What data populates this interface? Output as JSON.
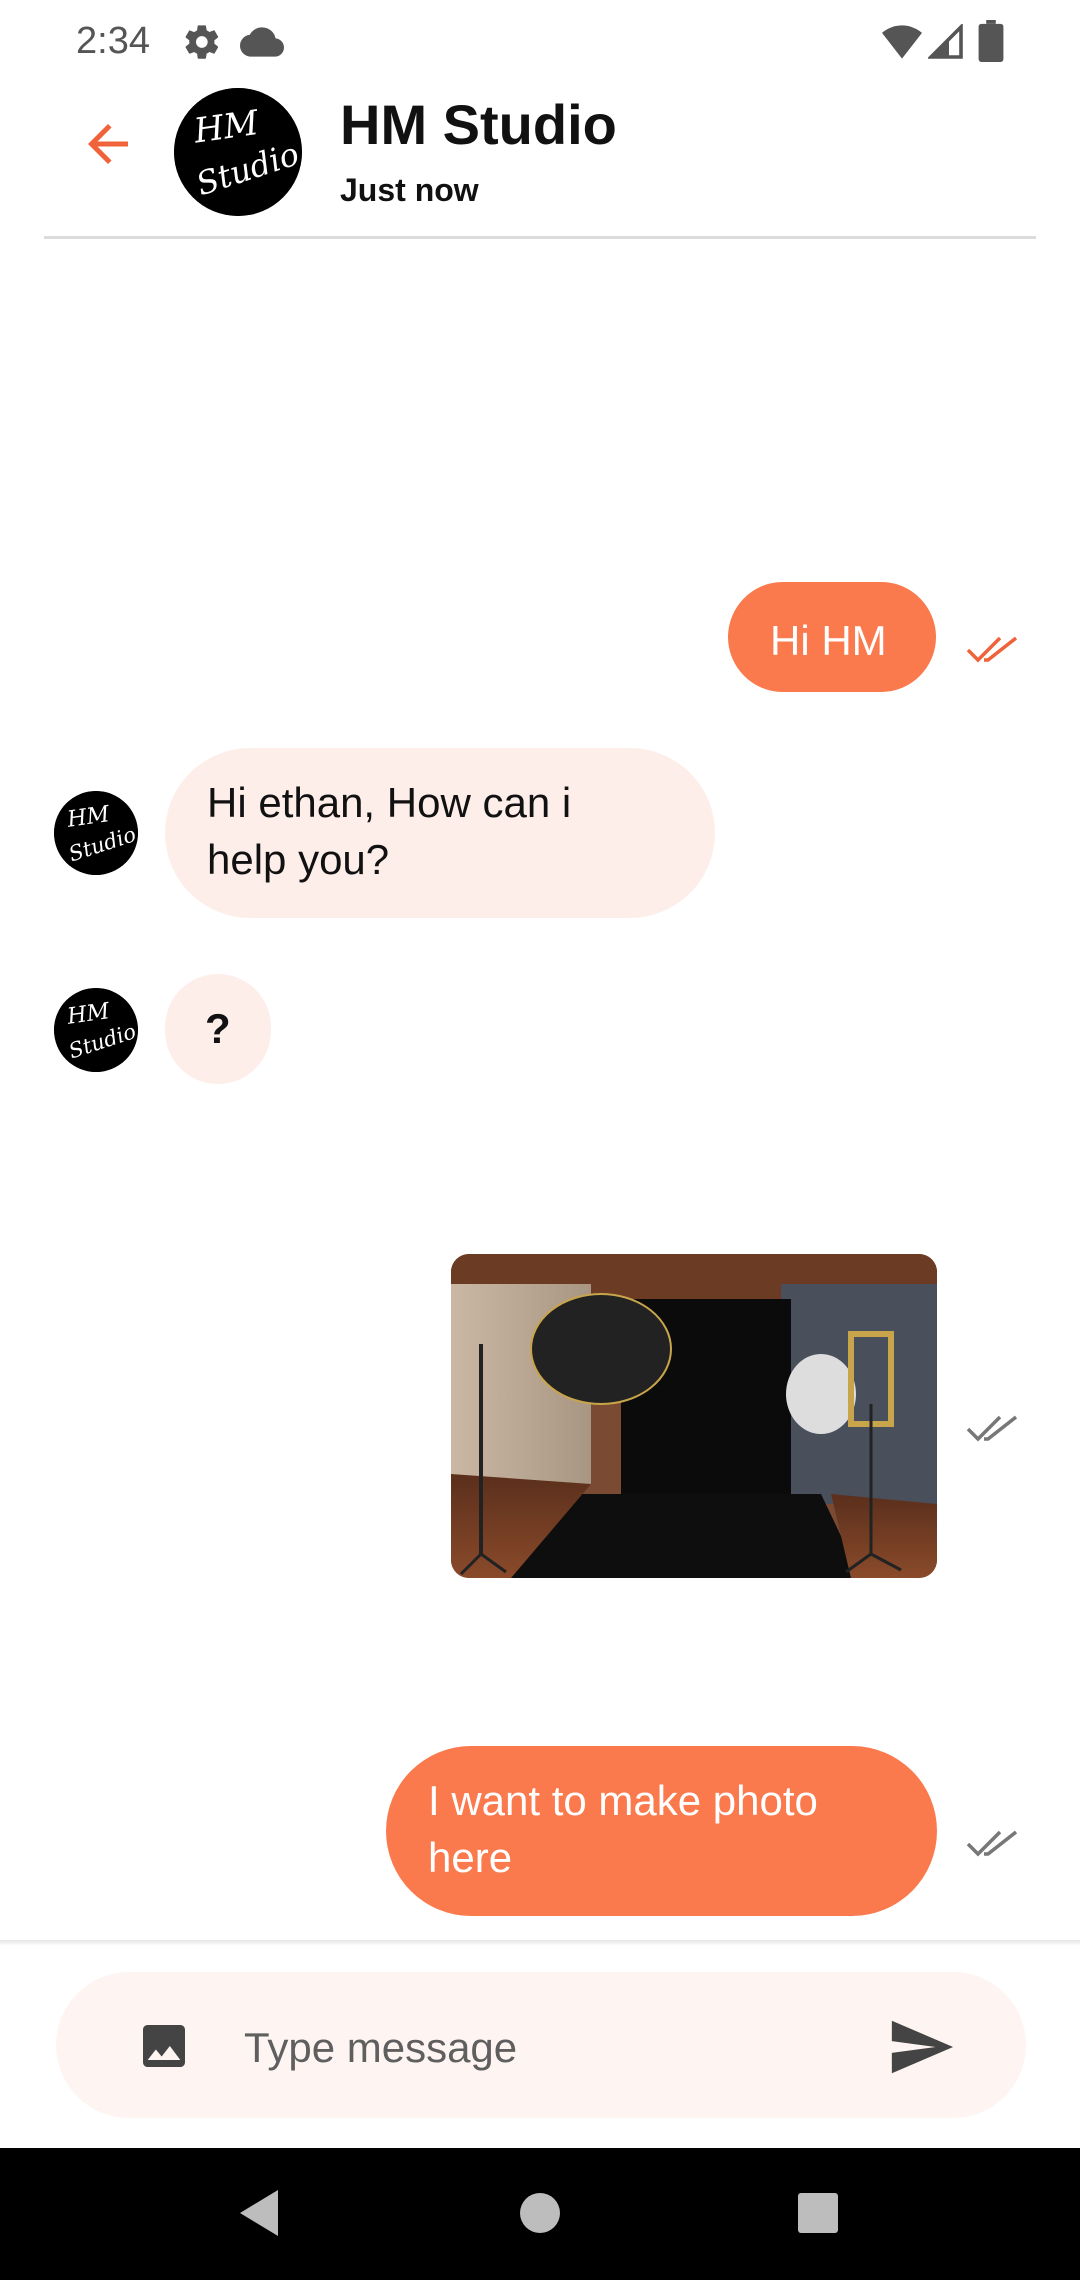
{
  "status_bar": {
    "time": "2:34",
    "icons": [
      "settings-icon",
      "cloud-icon",
      "wifi-icon",
      "signal-icon",
      "battery-icon"
    ]
  },
  "header": {
    "title": "HM Studio",
    "subtitle": "Just now",
    "avatar_text": [
      "HM",
      "Studio"
    ],
    "back_icon": "arrow-back-icon"
  },
  "messages": [
    {
      "type": "text",
      "direction": "outgoing",
      "text": "Hi HM",
      "status": "read"
    },
    {
      "type": "text",
      "direction": "incoming",
      "text": "Hi ethan, How can i help you?"
    },
    {
      "type": "text",
      "direction": "incoming",
      "text": "?"
    },
    {
      "type": "image",
      "direction": "outgoing",
      "status": "delivered"
    },
    {
      "type": "text",
      "direction": "outgoing",
      "text": "I want to make photo here",
      "status": "delivered"
    }
  ],
  "composer": {
    "placeholder": "Type message",
    "image_icon": "image-icon",
    "send_icon": "send-icon"
  },
  "colors": {
    "accent": "#fa7a4d",
    "incoming_bubble": "#fdeeea",
    "composer_bg": "#fef4f1",
    "read_tick": "#f0623a",
    "delivered_tick": "#777777"
  },
  "nav_bar": [
    "back-triangle-icon",
    "home-circle-icon",
    "recents-square-icon"
  ]
}
